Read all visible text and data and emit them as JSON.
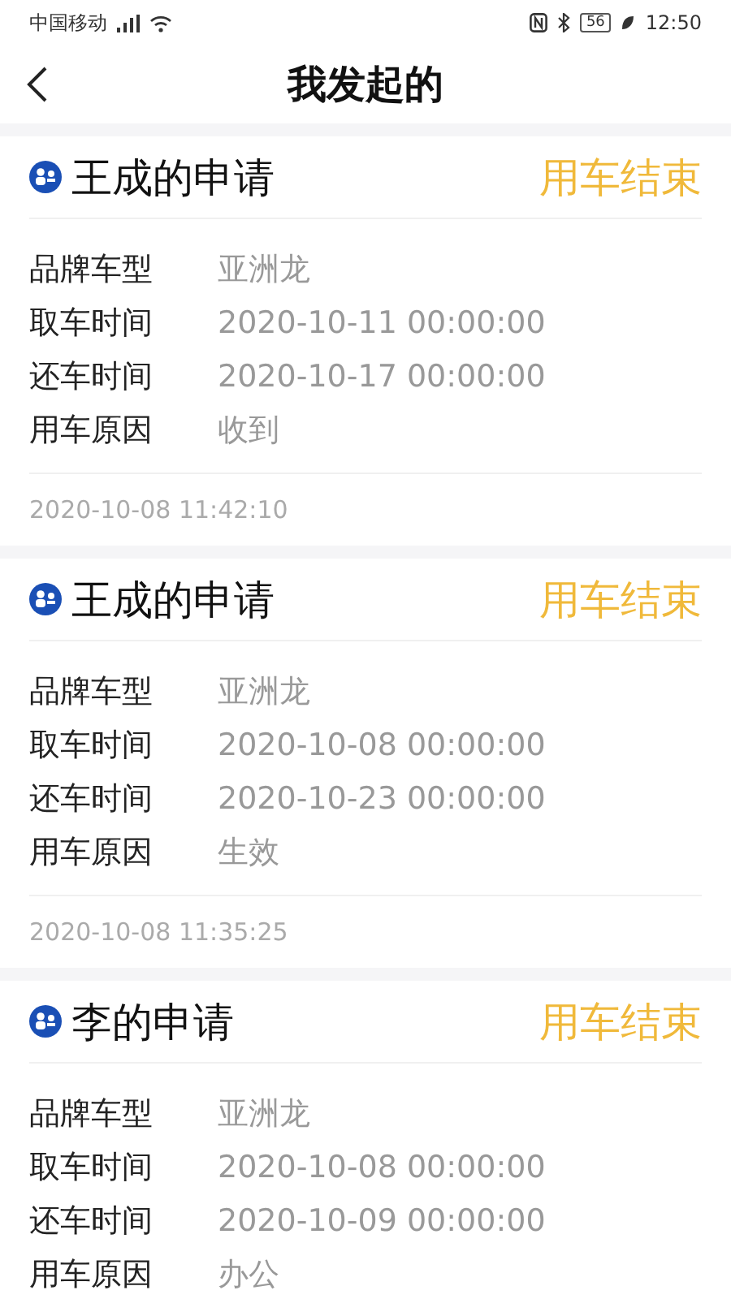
{
  "status_bar": {
    "carrier": "中国移动",
    "battery": "56",
    "time": "12:50"
  },
  "header": {
    "title": "我发起的"
  },
  "cards": [
    {
      "title": "王成的申请",
      "status": "用车结束",
      "fields": [
        {
          "label": "品牌车型",
          "value": "亚洲龙"
        },
        {
          "label": "取车时间",
          "value": "2020-10-11 00:00:00"
        },
        {
          "label": "还车时间",
          "value": "2020-10-17 00:00:00"
        },
        {
          "label": "用车原因",
          "value": "收到"
        }
      ],
      "timestamp": "2020-10-08 11:42:10"
    },
    {
      "title": "王成的申请",
      "status": "用车结束",
      "fields": [
        {
          "label": "品牌车型",
          "value": "亚洲龙"
        },
        {
          "label": "取车时间",
          "value": "2020-10-08 00:00:00"
        },
        {
          "label": "还车时间",
          "value": "2020-10-23 00:00:00"
        },
        {
          "label": "用车原因",
          "value": "生效"
        }
      ],
      "timestamp": "2020-10-08 11:35:25"
    },
    {
      "title": "李的申请",
      "status": "用车结束",
      "fields": [
        {
          "label": "品牌车型",
          "value": "亚洲龙"
        },
        {
          "label": "取车时间",
          "value": "2020-10-08 00:00:00"
        },
        {
          "label": "还车时间",
          "value": "2020-10-09 00:00:00"
        },
        {
          "label": "用车原因",
          "value": "办公"
        }
      ]
    }
  ]
}
